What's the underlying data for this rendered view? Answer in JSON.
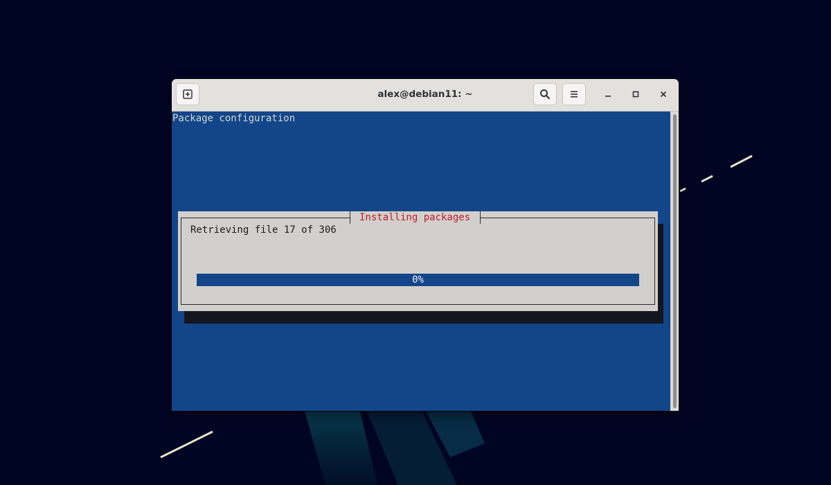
{
  "window": {
    "title": "alex@debian11: ~"
  },
  "titlebar": {
    "new_tab_icon": "new-tab-icon",
    "search_icon": "search-icon",
    "menu_icon": "hamburger-menu-icon",
    "minimize_icon": "minimize-icon",
    "maximize_icon": "maximize-icon",
    "close_icon": "close-icon"
  },
  "terminal": {
    "backtitle": "Package configuration",
    "dialog": {
      "title": "Installing packages",
      "message": "Retrieving file 17 of 306",
      "progress_label": "0%",
      "progress_fraction": 0
    }
  },
  "colors": {
    "terminal_bg": "#134589",
    "dialog_bg": "#d2d0cd",
    "dialog_title": "#c01c28",
    "desktop_bg": "#000523"
  }
}
